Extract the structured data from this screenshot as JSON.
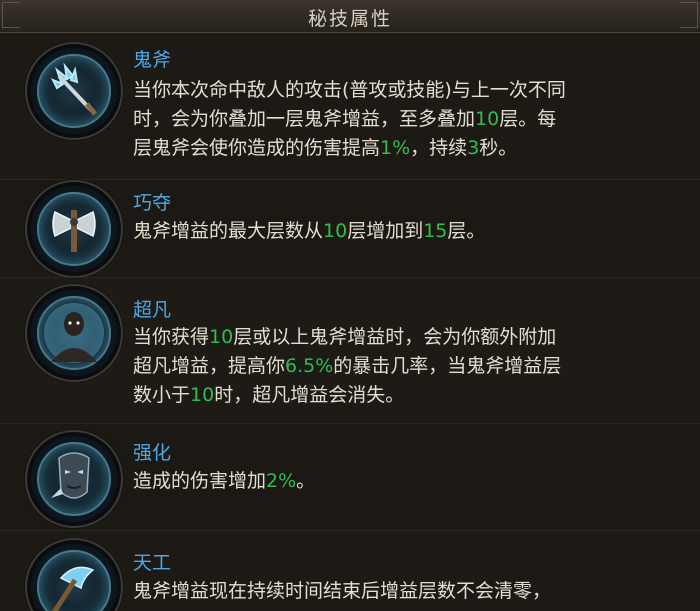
{
  "panel": {
    "title": "秘技属性"
  },
  "skills": [
    {
      "name": "鬼斧",
      "icon": "blue-spiked-axe-icon",
      "lines": [
        [
          {
            "t": "当你本次命中敌人的攻击(普攻或技能)与上一次不同"
          }
        ],
        [
          {
            "t": "时，会为你叠加一层鬼斧增益，至多叠加"
          },
          {
            "t": "10",
            "g": true
          },
          {
            "t": "层。每"
          }
        ],
        [
          {
            "t": "层鬼斧会使你造成的伤害提高"
          },
          {
            "t": "1%",
            "g": true
          },
          {
            "t": "，持续"
          },
          {
            "t": "3",
            "g": true
          },
          {
            "t": "秒。"
          }
        ]
      ]
    },
    {
      "name": "巧夺",
      "icon": "double-headed-axe-icon",
      "lines": [
        [
          {
            "t": "鬼斧增益的最大层数从"
          },
          {
            "t": "10",
            "g": true
          },
          {
            "t": "层增加到"
          },
          {
            "t": "15",
            "g": true
          },
          {
            "t": "层。"
          }
        ]
      ]
    },
    {
      "name": "超凡",
      "icon": "glowing-warrior-icon",
      "lines": [
        [
          {
            "t": "当你获得"
          },
          {
            "t": "10",
            "g": true
          },
          {
            "t": "层或以上鬼斧增益时，会为你额外附加"
          }
        ],
        [
          {
            "t": "超凡增益，提高你"
          },
          {
            "t": "6.5%",
            "g": true
          },
          {
            "t": "的暴击几率，当鬼斧增益层"
          }
        ],
        [
          {
            "t": "数小于"
          },
          {
            "t": "10",
            "g": true
          },
          {
            "t": "时，超凡增益会消失。"
          }
        ]
      ]
    },
    {
      "name": "强化",
      "icon": "masked-face-icon",
      "lines": [
        [
          {
            "t": "造成的伤害增加"
          },
          {
            "t": "2%",
            "g": true
          },
          {
            "t": "。"
          }
        ]
      ]
    },
    {
      "name": "天工",
      "icon": "curved-axe-icon",
      "lines": [
        [
          {
            "t": "鬼斧增益现在持续时间结束后增益层数不会清零，"
          }
        ]
      ]
    }
  ],
  "colors": {
    "skill_name": "#4aa9e6",
    "text": "#e4ddd0",
    "highlight": "#2fbe4e",
    "icon_glow": "#5abee6"
  }
}
